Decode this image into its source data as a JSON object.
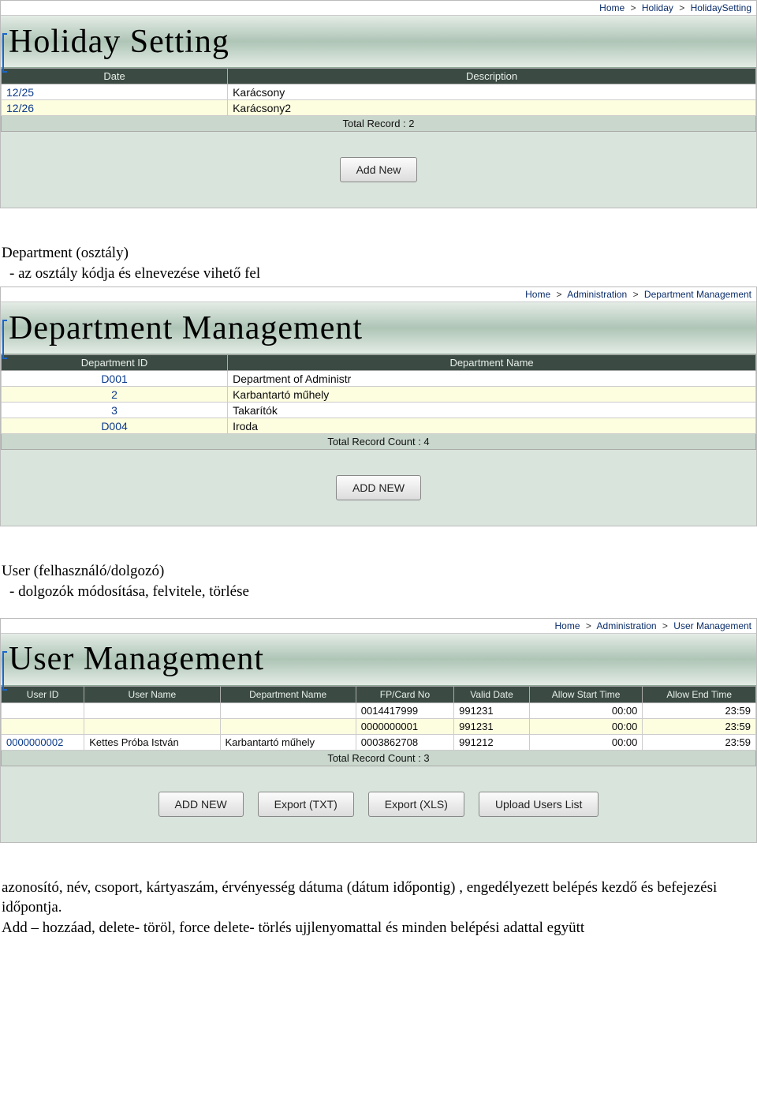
{
  "holiday": {
    "breadcrumb": {
      "home": "Home",
      "l1": "Holiday",
      "l2": "HolidaySetting"
    },
    "title": "Holiday Setting",
    "headers": {
      "date": "Date",
      "desc": "Description"
    },
    "rows": [
      {
        "date": "12/25",
        "desc": "Karácsony"
      },
      {
        "date": "12/26",
        "desc": "Karácsony2"
      }
    ],
    "total": "Total Record : 2",
    "add_button": "Add New"
  },
  "dept_intro": {
    "heading": "Department (osztály)",
    "line1": "-    az osztály kódja és elnevezése vihető fel"
  },
  "department": {
    "breadcrumb": {
      "home": "Home",
      "l1": "Administration",
      "l2": "Department Management"
    },
    "title": "Department Management",
    "headers": {
      "id": "Department ID",
      "name": "Department Name"
    },
    "rows": [
      {
        "id": "D001",
        "name": "Department of Administr",
        "link": true
      },
      {
        "id": "2",
        "name": "Karbantartó műhely",
        "link": true,
        "alt": true
      },
      {
        "id": "3",
        "name": "Takarítók",
        "link": true
      },
      {
        "id": "D004",
        "name": "Iroda",
        "link": true,
        "alt": true
      }
    ],
    "total": "Total Record Count : 4",
    "add_button": "ADD NEW"
  },
  "user_intro": {
    "heading": "User (felhasználó/dolgozó)",
    "line1": "-    dolgozók módosítása, felvitele, törlése"
  },
  "user": {
    "breadcrumb": {
      "home": "Home",
      "l1": "Administration",
      "l2": "User Management"
    },
    "title": "User Management",
    "headers": {
      "uid": "User ID",
      "uname": "User Name",
      "dname": "Department Name",
      "card": "FP/Card No",
      "valid": "Valid Date",
      "start": "Allow Start Time",
      "end": "Allow End Time"
    },
    "rows": [
      {
        "uid": "",
        "uname": "",
        "dname": "",
        "card": "0014417999",
        "valid": "991231",
        "start": "00:00",
        "end": "23:59"
      },
      {
        "uid": "",
        "uname": "",
        "dname": "",
        "card": "0000000001",
        "valid": "991231",
        "start": "00:00",
        "end": "23:59",
        "alt": true
      },
      {
        "uid": "0000000002",
        "uname": "Kettes Próba István",
        "dname": "Karbantartó műhely",
        "card": "0003862708",
        "valid": "991212",
        "start": "00:00",
        "end": "23:59",
        "link": true
      }
    ],
    "total": "Total Record Count : 3",
    "buttons": {
      "add": "ADD NEW",
      "export_txt": "Export (TXT)",
      "export_xls": "Export (XLS)",
      "upload": "Upload Users List"
    }
  },
  "footer_text": {
    "p1": "azonosító, név, csoport, kártyaszám, érvényesség dátuma (dátum időpontig) , engedélyezett belépés kezdő és befejezési időpontja.",
    "p2": "Add – hozzáad, delete- töröl, force delete- törlés ujjlenyomattal és minden belépési adattal együtt"
  }
}
